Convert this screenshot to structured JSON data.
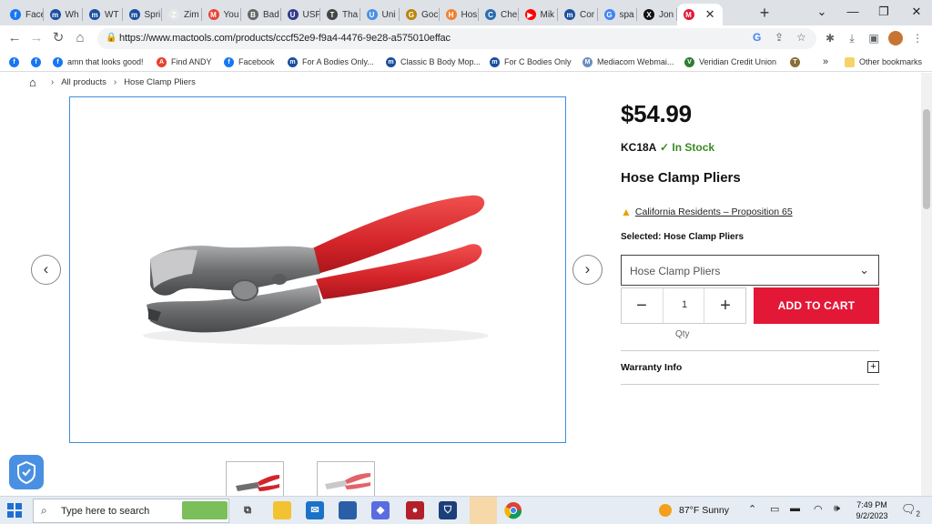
{
  "browser": {
    "tabs": [
      {
        "label": "Face",
        "color": "#1877f2",
        "glyph": "f"
      },
      {
        "label": "Wh",
        "color": "#1a4fa0",
        "glyph": "m"
      },
      {
        "label": "WT",
        "color": "#1a4fa0",
        "glyph": "m"
      },
      {
        "label": "Spri",
        "color": "#1a4fa0",
        "glyph": "m"
      },
      {
        "label": "Zim",
        "color": "#e8e8e8",
        "glyph": "Z"
      },
      {
        "label": "You",
        "color": "#ea4335",
        "glyph": "M"
      },
      {
        "label": "Bad",
        "color": "#666666",
        "glyph": "B"
      },
      {
        "label": "USP",
        "color": "#333a8c",
        "glyph": "U"
      },
      {
        "label": "Tha",
        "color": "#444444",
        "glyph": "T"
      },
      {
        "label": "Uni",
        "color": "#4a90e2",
        "glyph": "U"
      },
      {
        "label": "Goc",
        "color": "#b8860b",
        "glyph": "G"
      },
      {
        "label": "Hos",
        "color": "#f08030",
        "glyph": "H"
      },
      {
        "label": "Che",
        "color": "#2b6cb0",
        "glyph": "C"
      },
      {
        "label": "Mik",
        "color": "#ff0000",
        "glyph": "▶"
      },
      {
        "label": "Cor",
        "color": "#1a4fa0",
        "glyph": "m"
      },
      {
        "label": "spa",
        "color": "#4285f4",
        "glyph": "G"
      },
      {
        "label": "Jon",
        "color": "#111111",
        "glyph": "X"
      },
      {
        "label": "",
        "color": "#e31837",
        "glyph": "M"
      }
    ],
    "new_tab": "+",
    "window_controls": [
      "⌄",
      "—",
      "❐",
      "✕"
    ],
    "url": "https://www.mactools.com/products/cccf52e9-f9a4-4476-9e28-a575010effac",
    "bookmarks": [
      {
        "label": "",
        "color": "#1877f2",
        "glyph": "f"
      },
      {
        "label": "",
        "color": "#1877f2",
        "glyph": "f"
      },
      {
        "label": "amn that looks good!",
        "color": "#1877f2",
        "glyph": "f"
      },
      {
        "label": "Find ANDY",
        "color": "#e8412c",
        "glyph": "A"
      },
      {
        "label": "Facebook",
        "color": "#1877f2",
        "glyph": "f"
      },
      {
        "label": "For A Bodies Only...",
        "color": "#1a4fa0",
        "glyph": "m"
      },
      {
        "label": "Classic B Body Mop...",
        "color": "#1a4fa0",
        "glyph": "m"
      },
      {
        "label": "For C Bodies Only",
        "color": "#1a4fa0",
        "glyph": "m"
      },
      {
        "label": "Mediacom Webmai...",
        "color": "#6b8ec2",
        "glyph": "M"
      },
      {
        "label": "Veridian Credit Union",
        "color": "#2e7d32",
        "glyph": "V"
      },
      {
        "label": "",
        "color": "#8a6d3b",
        "glyph": "T"
      }
    ],
    "bookmarks_more": "»",
    "other_bookmarks": "Other bookmarks"
  },
  "page": {
    "breadcrumb": {
      "link": "All products",
      "current": "Hose Clamp Pliers"
    },
    "product": {
      "price": "$54.99",
      "sku": "KC18A",
      "stock": "✓ In Stock",
      "title": "Hose Clamp Pliers",
      "prop65": "California Residents – Proposition 65",
      "selected": "Selected: Hose Clamp Pliers",
      "variant": "Hose Clamp Pliers",
      "quantity": "1",
      "qty_label": "Qty",
      "add_to_cart": "ADD TO CART",
      "warranty": "Warranty Info"
    },
    "colors": {
      "brand_red": "#e31837",
      "stock_green": "#3a8a21",
      "handle_red": "#d4242a"
    }
  },
  "taskbar": {
    "search_placeholder": "Type here to search",
    "weather": "87°F  Sunny",
    "time": "7:49 PM",
    "date": "9/2/2023",
    "notifications": "2"
  }
}
